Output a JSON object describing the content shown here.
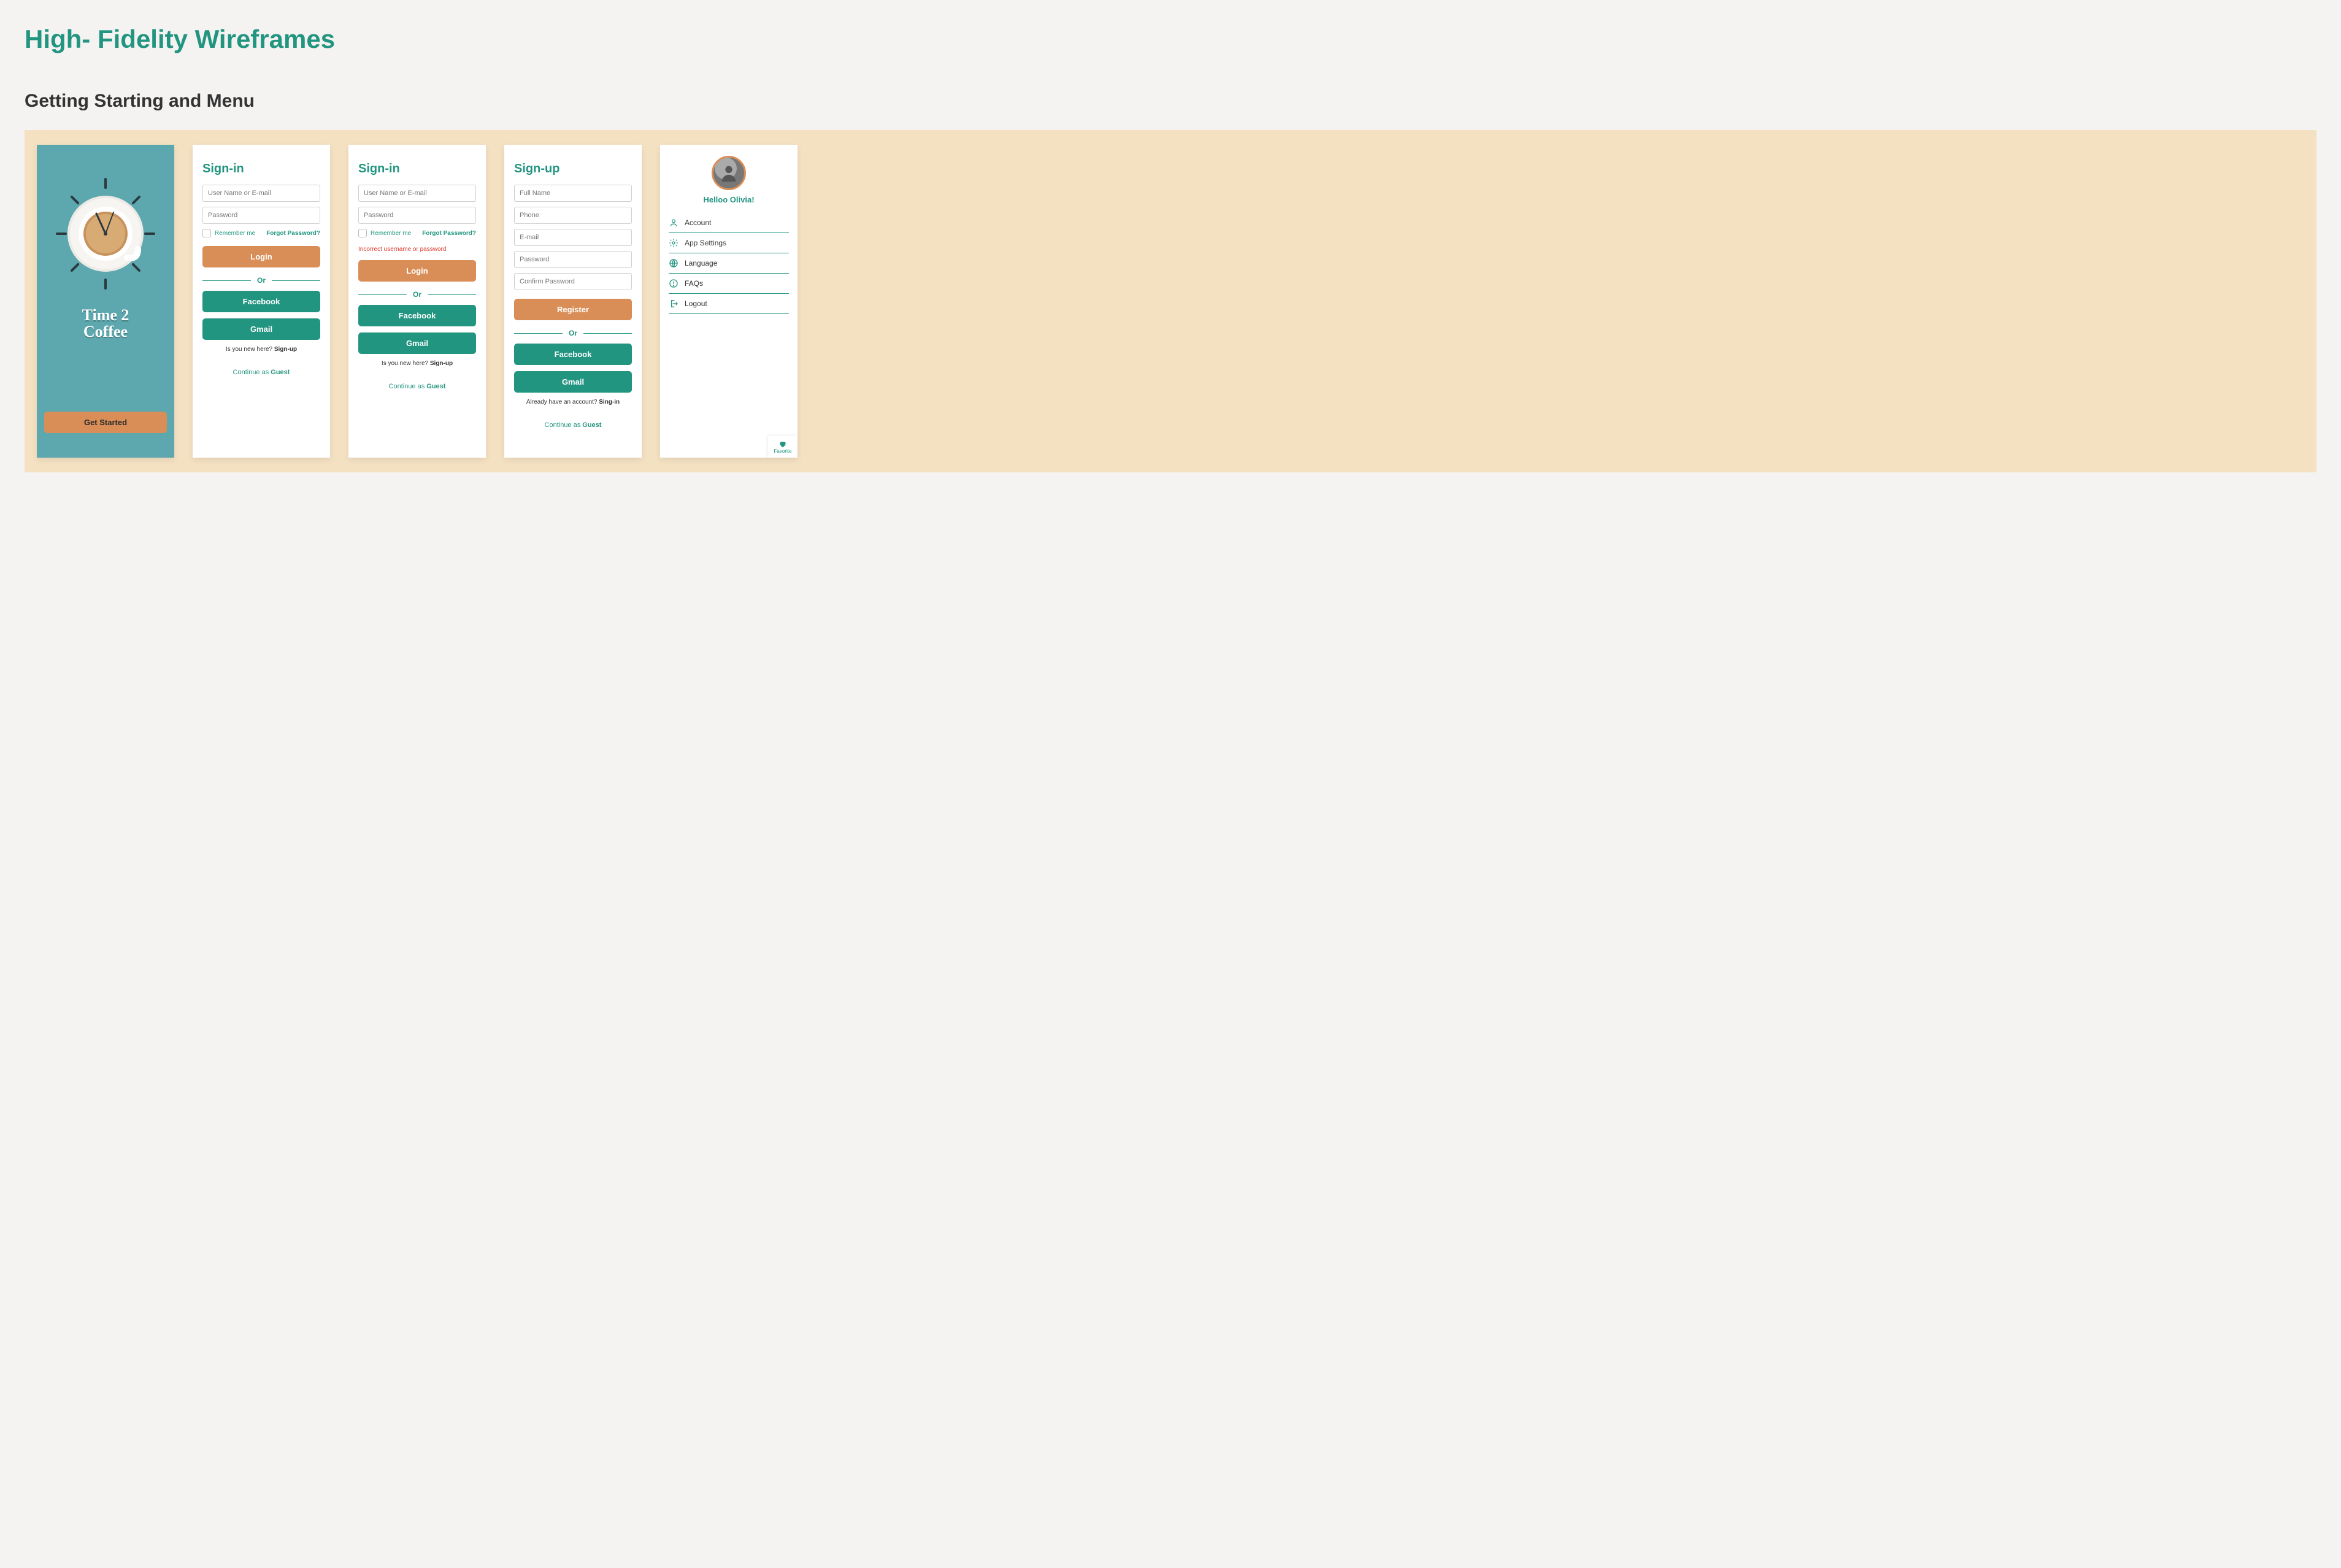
{
  "page_title": "High- Fidelity Wireframes",
  "section_title": "Getting Starting and Menu",
  "colors": {
    "teal": "#229580",
    "orange": "#d98e57",
    "splash_bg": "#5da7ae"
  },
  "splash": {
    "brand_line1": "Time 2",
    "brand_line2": "Coffee",
    "get_started": "Get Started"
  },
  "signin": {
    "heading": "Sign-in",
    "username_placeholder": "User Name or E-mail",
    "password_placeholder": "Password",
    "remember_label": "Remember me",
    "forgot_label": "Forgot Password?",
    "login_label": "Login",
    "or_label": "Or",
    "facebook_label": "Facebook",
    "gmail_label": "Gmail",
    "new_here_text": "Is you new here? ",
    "signup_link": "Sign-up",
    "guest_prefix": "Continue as ",
    "guest_link": "Guest"
  },
  "signin_error": {
    "error_text": "Incorrect username or password"
  },
  "signup": {
    "heading": "Sign-up",
    "fullname_placeholder": "Full Name",
    "phone_placeholder": "Phone",
    "email_placeholder": "E-mail",
    "password_placeholder": "Password",
    "confirm_placeholder": "Confirm Password",
    "register_label": "Register",
    "or_label": "Or",
    "facebook_label": "Facebook",
    "gmail_label": "Gmail",
    "already_text": "Already have an account? ",
    "signin_link": "Sing-in",
    "guest_prefix": "Continue as ",
    "guest_link": "Guest"
  },
  "menu": {
    "greeting": "Helloo Olivia!",
    "items": [
      {
        "icon": "account-icon",
        "label": "Account"
      },
      {
        "icon": "settings-icon",
        "label": "App Settings"
      },
      {
        "icon": "language-icon",
        "label": "Language"
      },
      {
        "icon": "faqs-icon",
        "label": "FAQs"
      },
      {
        "icon": "logout-icon",
        "label": "Logout"
      }
    ],
    "favorite_label": "Favorite"
  }
}
